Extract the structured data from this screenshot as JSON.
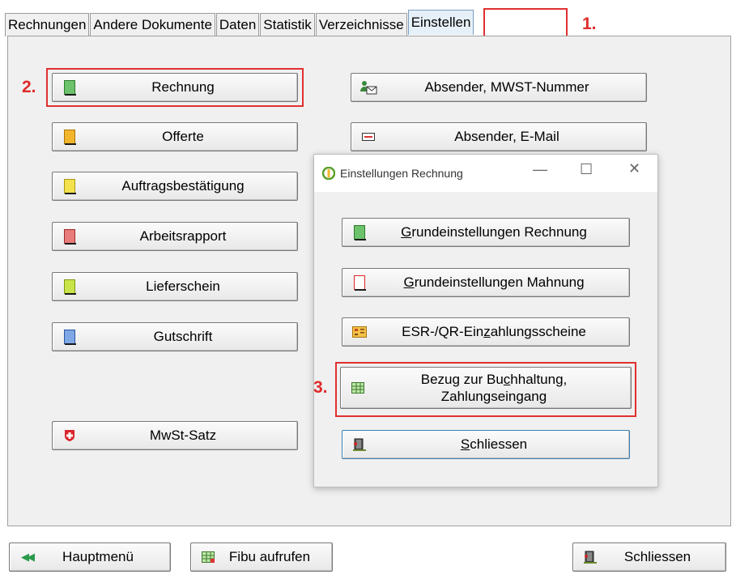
{
  "tabs": [
    "Rechnungen",
    "Andere Dokumente",
    "Daten",
    "Statistik",
    "Verzeichnisse",
    "Einstellen"
  ],
  "annotations": {
    "one": "1.",
    "two": "2.",
    "three": "3."
  },
  "left_buttons": {
    "rechnung": "Rechnung",
    "offerte": "Offerte",
    "auftrag": "Auftragsbestätigung",
    "arbeitsrapport": "Arbeitsrapport",
    "lieferschein": "Lieferschein",
    "gutschrift": "Gutschrift",
    "mwst": "MwSt-Satz"
  },
  "right_buttons": {
    "absender_mwst": "Absender, MWST-Nummer",
    "absender_email": "Absender, E-Mail"
  },
  "dialog": {
    "title": "Einstellungen Rechnung",
    "grund_rechnung": {
      "pre": "",
      "ul": "G",
      "post": "rundeinstellungen Rechnung"
    },
    "grund_mahnung": {
      "pre": "",
      "ul": "G",
      "post": "rundeinstellungen Mahnung"
    },
    "esr": {
      "pre": "ESR-/QR-Ein",
      "ul": "z",
      "post": "ahlungsscheine"
    },
    "bezug_line1": {
      "pre": "Bezug zur Bu",
      "ul": "c",
      "post": "hhaltung,"
    },
    "bezug_line2": "Zahlungseingang",
    "schliessen": {
      "pre": "",
      "ul": "S",
      "post": "chliessen"
    }
  },
  "bottom": {
    "hauptmenu": "Hauptmenü",
    "fibu": "Fibu aufrufen",
    "schliessen": "Schliessen"
  },
  "colors": {
    "annotation": "#e02a2a",
    "dialog_bg": "#f0f0f0"
  }
}
